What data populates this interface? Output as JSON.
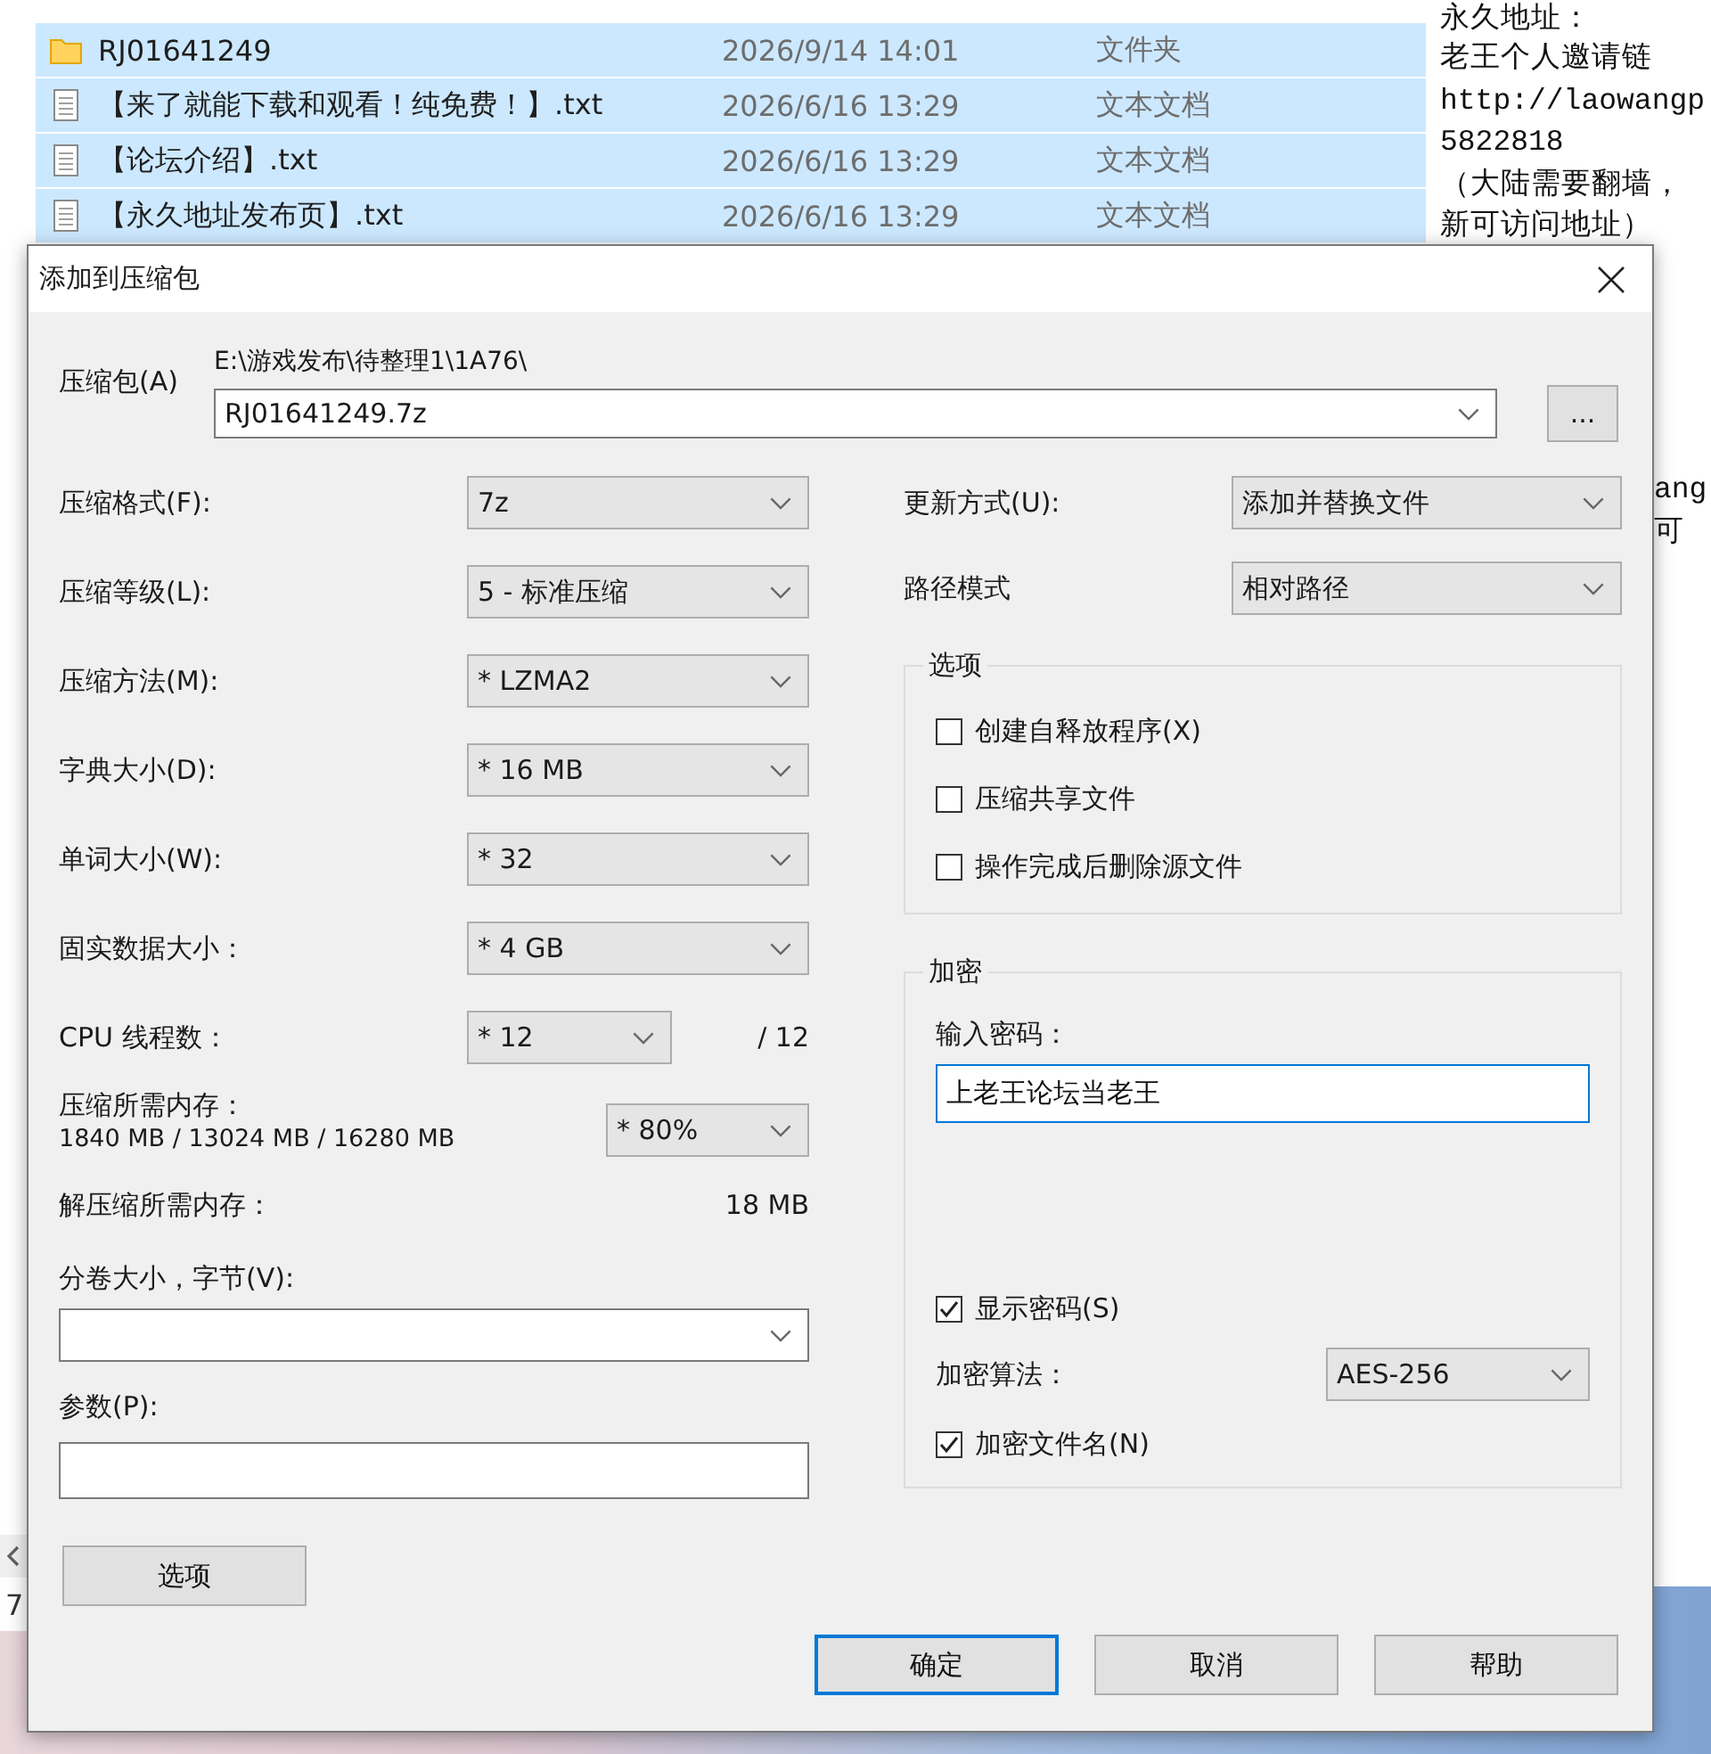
{
  "explorer": {
    "files": [
      {
        "kind": "folder",
        "name": "RJ01641249",
        "modified": "2026/9/14 14:01",
        "type": "文件夹",
        "selected": true
      },
      {
        "kind": "text",
        "name": "【来了就能下载和观看！纯免费！】.txt",
        "modified": "2026/6/16 13:29",
        "type": "文本文档",
        "selected": true
      },
      {
        "kind": "text",
        "name": "【论坛介绍】.txt",
        "modified": "2026/6/16 13:29",
        "type": "文本文档",
        "selected": true
      },
      {
        "kind": "text",
        "name": "【永久地址发布页】.txt",
        "modified": "2026/6/16 13:29",
        "type": "文本文档",
        "selected": true
      }
    ],
    "status": "7"
  },
  "note": {
    "lines": [
      "永久地址：",
      "老王个人邀请链",
      "http://laowangp",
      "5822818",
      "（大陆需要翻墙，",
      "新可访问地址）"
    ],
    "fragments": [
      "ang",
      "可"
    ]
  },
  "dialog": {
    "title": "添加到压缩包",
    "archive": {
      "label": "压缩包(A)",
      "folder": "E:\\游戏发布\\待整理1\\1A76\\",
      "value": "RJ01641249.7z",
      "browse": "..."
    },
    "settings": [
      {
        "kind": "combo",
        "label": "压缩格式(F):",
        "value": "7z"
      },
      {
        "kind": "combo",
        "label": "压缩等级(L):",
        "value": "5 - 标准压缩"
      },
      {
        "kind": "combo",
        "label": "压缩方法(M):",
        "value": "* LZMA2"
      },
      {
        "kind": "combo",
        "label": "字典大小(D):",
        "value": "* 16 MB"
      },
      {
        "kind": "combo",
        "label": "单词大小(W):",
        "value": "* 32"
      },
      {
        "kind": "combo",
        "label": "固实数据大小：",
        "value": "* 4 GB"
      },
      {
        "kind": "combo-with-total",
        "label": "CPU 线程数：",
        "value": "* 12",
        "suffix": "/ 12"
      }
    ],
    "memory": {
      "label": "压缩所需内存：",
      "reading": "1840 MB / 13024 MB / 16280 MB",
      "value": "* 80%"
    },
    "decompression": {
      "label": "解压缩所需内存：",
      "reading": "18 MB"
    },
    "volumes": {
      "label": "分卷大小，字节(V):"
    },
    "parameters": {
      "label": "参数(P):"
    },
    "options_button": "选项",
    "update": {
      "label": "更新方式(U):",
      "value": "添加并替换文件"
    },
    "path_mode": {
      "label": "路径模式",
      "value": "相对路径"
    },
    "options": {
      "title": "选项",
      "checkboxes": [
        {
          "label": "创建自释放程序(X)",
          "checked": false
        },
        {
          "label": "压缩共享文件",
          "checked": false
        },
        {
          "label": "操作完成后删除源文件",
          "checked": false
        }
      ]
    },
    "encryption": {
      "title": "加密",
      "password_label": "输入密码：",
      "password": "上老王论坛当老王",
      "password_focused": true,
      "show_password": {
        "label": "显示密码(S)",
        "checked": true
      },
      "method": {
        "label": "加密算法：",
        "value": "AES-256"
      },
      "encrypt_names": {
        "label": "加密文件名(N)",
        "checked": true
      }
    },
    "buttons": [
      {
        "label": "确定",
        "focused": true
      },
      {
        "label": "取消",
        "focused": false
      },
      {
        "label": "帮助",
        "focused": false
      }
    ]
  }
}
